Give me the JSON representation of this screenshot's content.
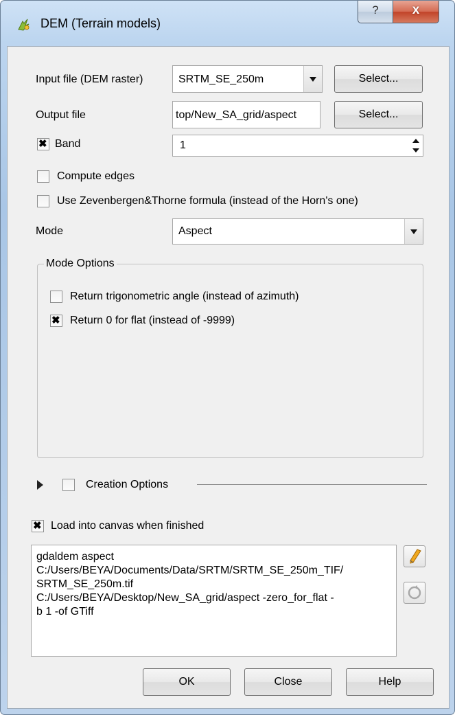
{
  "window": {
    "title": "DEM (Terrain models)",
    "help_label": "?",
    "close_label": "x"
  },
  "form": {
    "input_label": "Input file (DEM raster)",
    "input_value": "SRTM_SE_250m",
    "input_select_label": "Select...",
    "output_label": "Output file",
    "output_value": "top/New_SA_grid/aspect",
    "output_select_label": "Select...",
    "band_label": "Band",
    "band_checked": true,
    "band_value": "1",
    "compute_edges_label": "Compute edges",
    "compute_edges_checked": false,
    "zevenbergen_label": "Use Zevenbergen&Thorne formula (instead of the Horn's one)",
    "zevenbergen_checked": false,
    "mode_label": "Mode",
    "mode_value": "Aspect"
  },
  "mode_options": {
    "title": "Mode Options",
    "trig_label": "Return trigonometric angle (instead of azimuth)",
    "trig_checked": false,
    "zero_flat_label": "Return 0 for flat (instead of -9999)",
    "zero_flat_checked": true
  },
  "creation_options": {
    "label": "Creation Options",
    "checked": false
  },
  "load_canvas": {
    "label": "Load into canvas when finished",
    "checked": true
  },
  "command": {
    "text": "gdaldem aspect\nC:/Users/BEYA/Documents/Data/SRTM/SRTM_SE_250m_TIF/\nSRTM_SE_250m.tif\nC:/Users/BEYA/Desktop/New_SA_grid/aspect -zero_for_flat -\nb 1 -of GTiff"
  },
  "footer": {
    "ok_label": "OK",
    "close_label": "Close",
    "help_label": "Help"
  },
  "icons": {
    "app": "qgis-icon",
    "edit": "pencil-icon",
    "reset": "reset-icon"
  }
}
